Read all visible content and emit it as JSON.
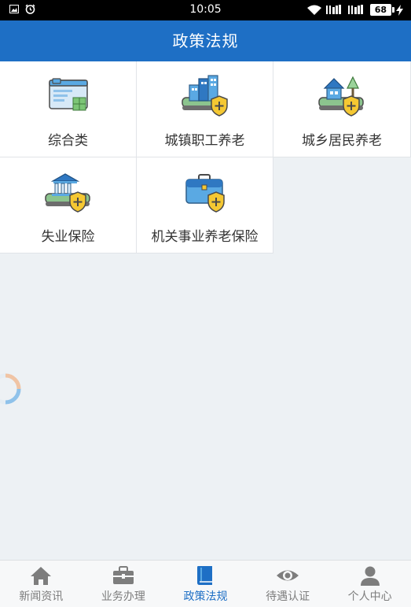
{
  "status_bar": {
    "time": "10:05",
    "battery": "68"
  },
  "header": {
    "title": "政策法规"
  },
  "categories": [
    {
      "label": "综合类",
      "icon": "browser-window-icon"
    },
    {
      "label": "城镇职工养老",
      "icon": "city-buildings-shield-icon"
    },
    {
      "label": "城乡居民养老",
      "icon": "house-tree-shield-icon"
    },
    {
      "label": "失业保险",
      "icon": "bank-shield-icon"
    },
    {
      "label": "机关事业养老保险",
      "icon": "briefcase-shield-icon"
    }
  ],
  "tabs": [
    {
      "label": "新闻资讯",
      "icon": "home-icon",
      "active": false
    },
    {
      "label": "业务办理",
      "icon": "briefcase-icon",
      "active": false
    },
    {
      "label": "政策法规",
      "icon": "book-icon",
      "active": true
    },
    {
      "label": "待遇认证",
      "icon": "eye-icon",
      "active": false
    },
    {
      "label": "个人中心",
      "icon": "person-icon",
      "active": false
    }
  ],
  "colors": {
    "brand": "#1e6fc5",
    "tab_inactive": "#7d7d7d",
    "background": "#edf1f4"
  }
}
